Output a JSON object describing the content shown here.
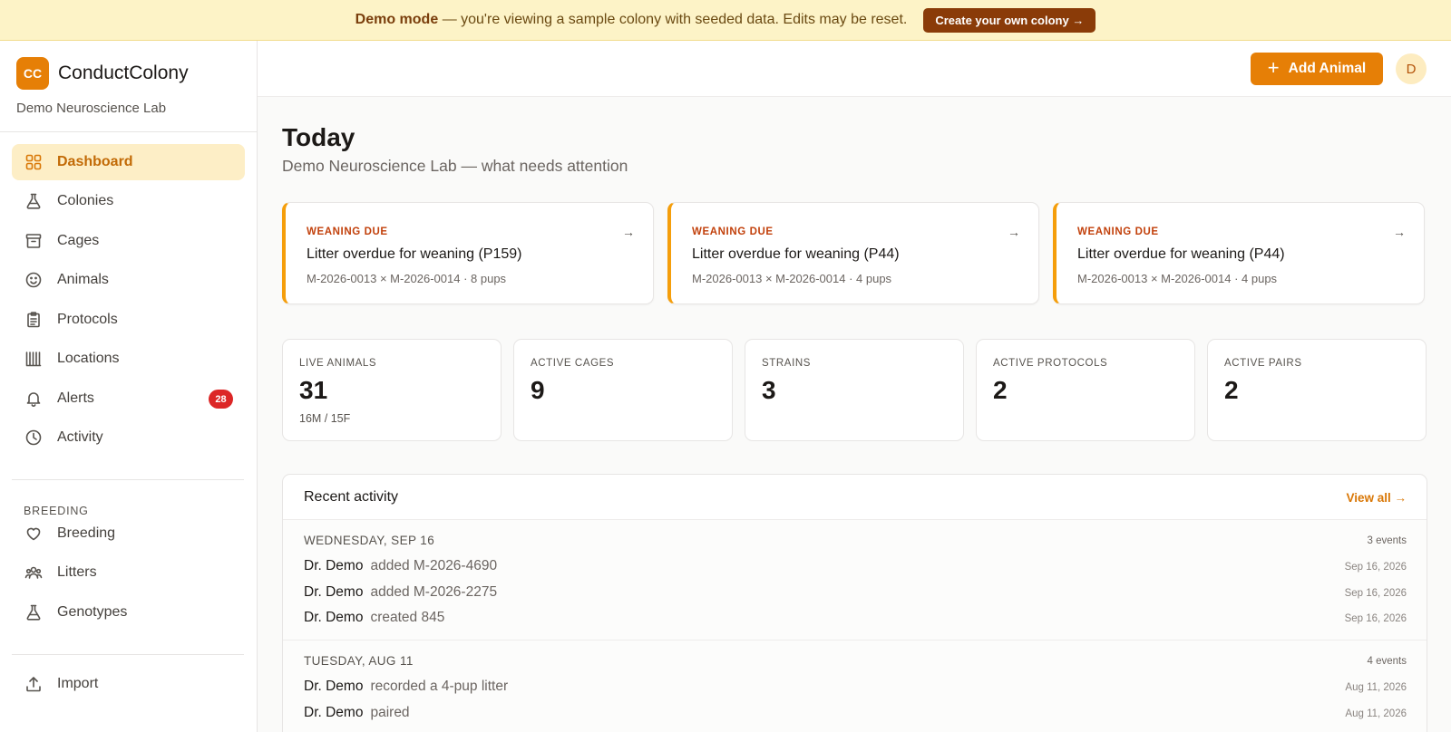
{
  "banner": {
    "strong": "Demo mode",
    "text": "— you're viewing a sample colony with seeded data. Edits may be reset.",
    "cta": "Create your own colony →"
  },
  "brand": {
    "logo": "CC",
    "name": "ConductColony",
    "lab": "Demo Neuroscience Lab"
  },
  "nav": {
    "items": [
      {
        "label": "Dashboard",
        "icon": "grid-icon"
      },
      {
        "label": "Colonies",
        "icon": "flask-icon"
      },
      {
        "label": "Cages",
        "icon": "archive-box-icon"
      },
      {
        "label": "Animals",
        "icon": "smile-icon"
      },
      {
        "label": "Protocols",
        "icon": "clipboard-icon"
      },
      {
        "label": "Locations",
        "icon": "rack-icon"
      },
      {
        "label": "Alerts",
        "icon": "bell-icon",
        "badge": "28"
      },
      {
        "label": "Activity",
        "icon": "clock-icon"
      }
    ],
    "section_label": "BREEDING",
    "breeding": [
      {
        "label": "Breeding",
        "icon": "heart-icon"
      },
      {
        "label": "Litters",
        "icon": "users-icon"
      },
      {
        "label": "Genotypes",
        "icon": "flask-icon"
      }
    ],
    "footer": [
      {
        "label": "Import",
        "icon": "upload-icon"
      }
    ]
  },
  "topbar": {
    "add_button": "Add Animal",
    "avatar": "D"
  },
  "page": {
    "title": "Today",
    "subtitle": "Demo Neuroscience Lab — what needs attention"
  },
  "alerts": [
    {
      "tag": "WEANING DUE",
      "title": "Litter overdue for weaning (P159)",
      "meta": "M-2026-0013 × M-2026-0014 · 8 pups"
    },
    {
      "tag": "WEANING DUE",
      "title": "Litter overdue for weaning (P44)",
      "meta": "M-2026-0013 × M-2026-0014 · 4 pups"
    },
    {
      "tag": "WEANING DUE",
      "title": "Litter overdue for weaning (P44)",
      "meta": "M-2026-0013 × M-2026-0014 · 4 pups"
    }
  ],
  "stats": [
    {
      "label": "LIVE ANIMALS",
      "value": "31",
      "sub": "16M / 15F"
    },
    {
      "label": "ACTIVE CAGES",
      "value": "9"
    },
    {
      "label": "STRAINS",
      "value": "3"
    },
    {
      "label": "ACTIVE PROTOCOLS",
      "value": "2"
    },
    {
      "label": "ACTIVE PAIRS",
      "value": "2"
    }
  ],
  "activity": {
    "title": "Recent activity",
    "view_all": "View all →",
    "days": [
      {
        "heading": "WEDNESDAY, SEP 16",
        "count": "3 events",
        "events": [
          {
            "actor": "Dr. Demo",
            "action": "added M-2026-4690",
            "date": "Sep 16, 2026"
          },
          {
            "actor": "Dr. Demo",
            "action": "added M-2026-2275",
            "date": "Sep 16, 2026"
          },
          {
            "actor": "Dr. Demo",
            "action": "created 845",
            "date": "Sep 16, 2026"
          }
        ]
      },
      {
        "heading": "TUESDAY, AUG 11",
        "count": "4 events",
        "events": [
          {
            "actor": "Dr. Demo",
            "action": "recorded a 4-pup litter",
            "date": "Aug 11, 2026"
          },
          {
            "actor": "Dr. Demo",
            "action": "paired",
            "date": "Aug 11, 2026"
          }
        ]
      }
    ]
  },
  "colors": {
    "accent": "#e67f06",
    "banner_bg": "#fdf3c7",
    "badge": "#dc2626",
    "alert_border": "#f59e0b"
  }
}
